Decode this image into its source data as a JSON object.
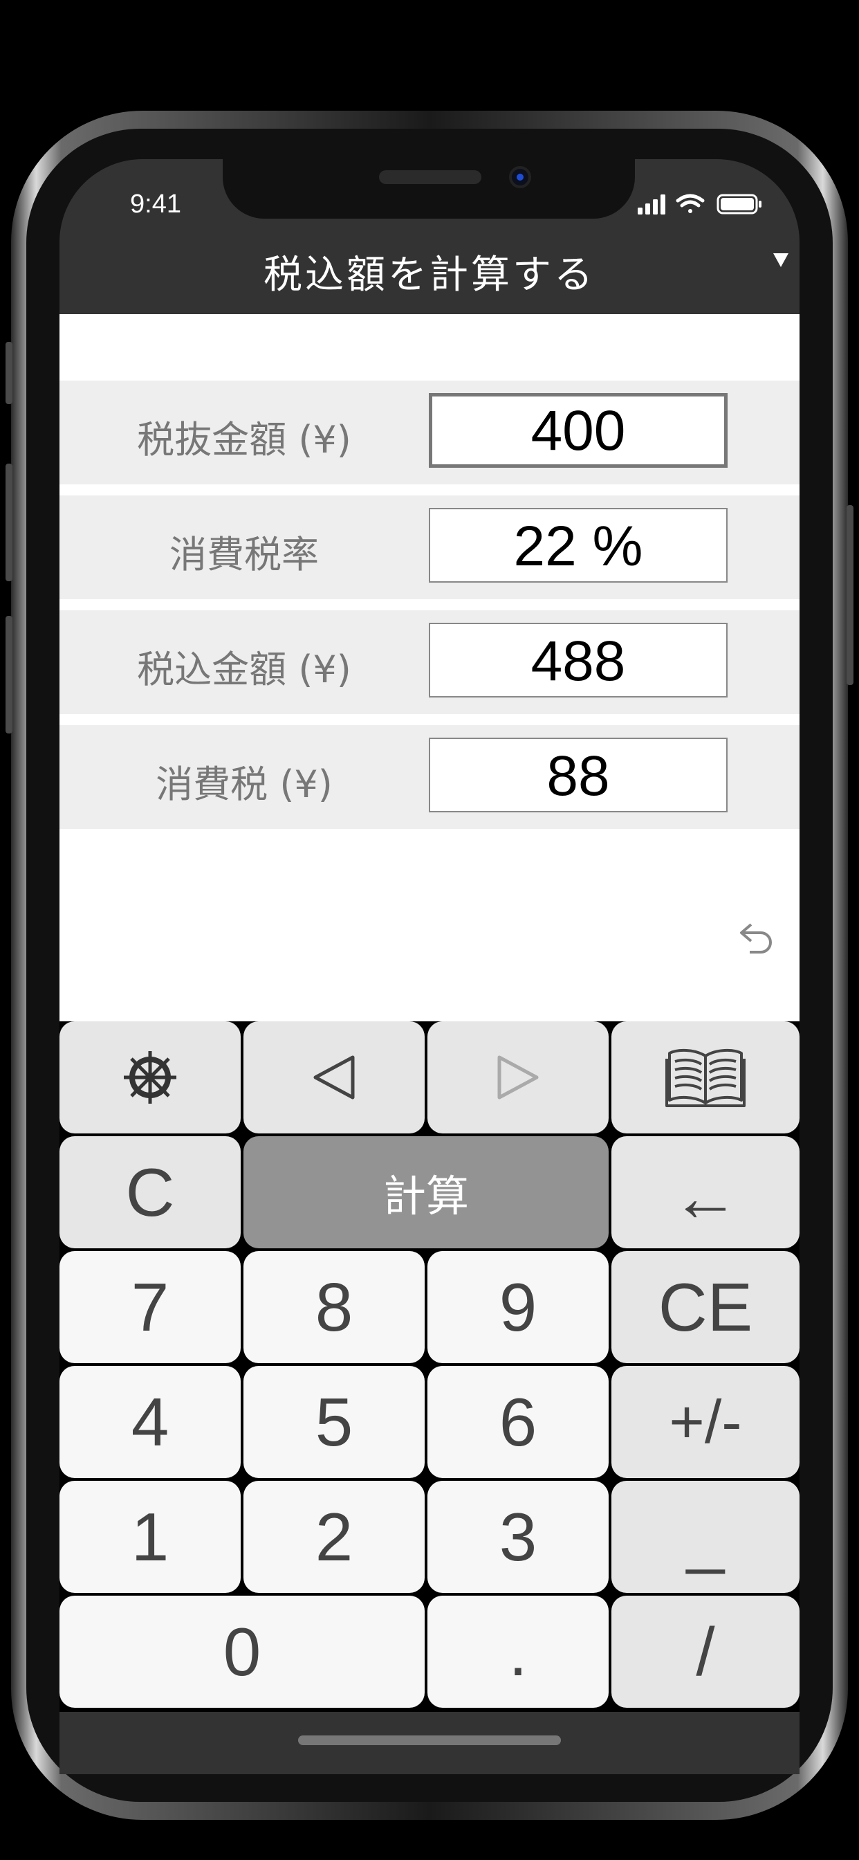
{
  "status_bar": {
    "time": "9:41"
  },
  "nav": {
    "title": "税込額を計算する"
  },
  "rows": [
    {
      "label": "税抜金額 (¥)",
      "value": "400"
    },
    {
      "label": "消費税率",
      "value": "22 %"
    },
    {
      "label": "税込金額 (¥)",
      "value": "488"
    },
    {
      "label": "消費税 (¥)",
      "value": "88"
    }
  ],
  "keypad": {
    "calc": "計算",
    "clear": "C",
    "backspace": "←",
    "clear_entry": "CE",
    "sign": "+/-",
    "k7": "7",
    "k8": "8",
    "k9": "9",
    "k4": "4",
    "k5": "5",
    "k6": "6",
    "k1": "1",
    "k2": "2",
    "k3": "3",
    "k0": "0",
    "dot": ".",
    "underscore": "_",
    "slash": "/"
  },
  "icons": {
    "settings": "dharma-wheel-icon",
    "left": "triangle-left-icon",
    "right": "triangle-right-icon",
    "book": "book-icon",
    "undo": "undo-icon"
  },
  "colors": {
    "nav_bg": "#333333",
    "row_bg": "#eeeeee",
    "calc_bg": "#939393"
  }
}
